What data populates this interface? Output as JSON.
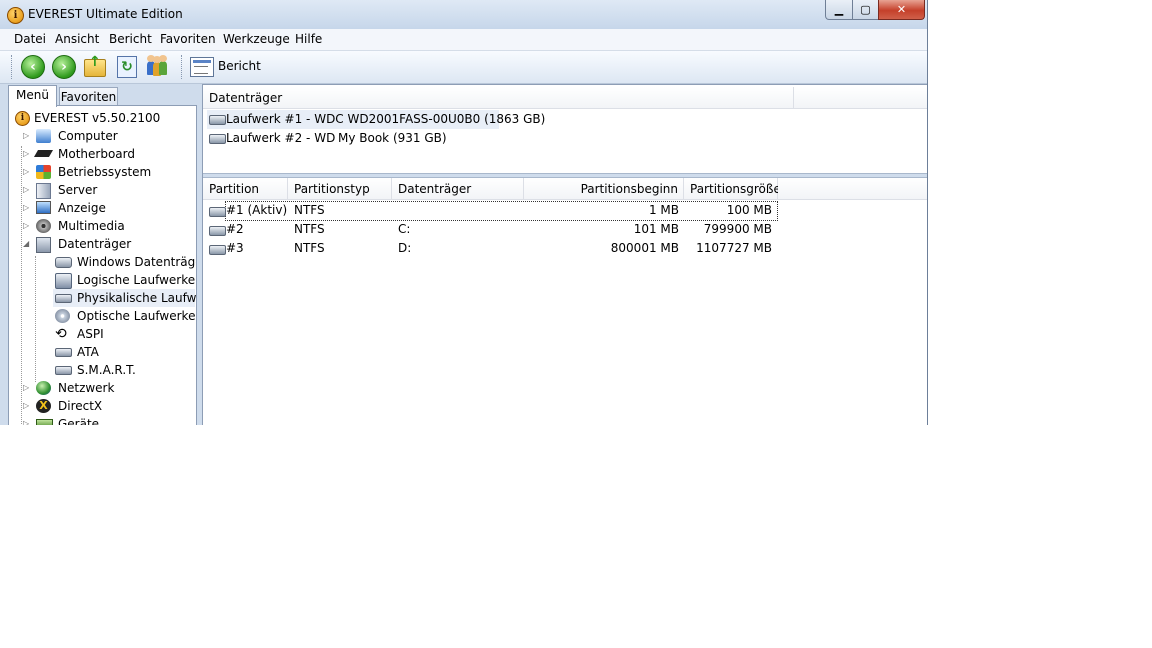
{
  "window": {
    "title": "EVEREST Ultimate Edition"
  },
  "menubar": [
    "Datei",
    "Ansicht",
    "Bericht",
    "Favoriten",
    "Werkzeuge",
    "Hilfe"
  ],
  "toolbar": {
    "icons": [
      "back-icon",
      "forward-icon",
      "up-folder-icon",
      "refresh-icon",
      "users-icon",
      "report-icon"
    ],
    "report_label": "Bericht"
  },
  "tabs": {
    "menu": "Menü",
    "favorites": "Favoriten"
  },
  "tree": {
    "root": "EVEREST v5.50.2100",
    "items": [
      "Computer",
      "Motherboard",
      "Betriebssystem",
      "Server",
      "Anzeige",
      "Multimedia",
      "Datenträger",
      "Netzwerk",
      "DirectX",
      "Geräte"
    ],
    "children": [
      "Windows Datenträger",
      "Logische Laufwerke",
      "Physikalische Laufwerk",
      "Optische Laufwerke",
      "ASPI",
      "ATA",
      "S.M.A.R.T."
    ],
    "selected": "Physikalische Laufwerk"
  },
  "drives": {
    "header": "Datenträger",
    "rows": [
      "Laufwerk #1 - WDC WD2001FASS-00U0B0 (1863 GB)",
      "Laufwerk #2 - WD",
      "My Book (931 GB)"
    ]
  },
  "partitions": {
    "headers": [
      "Partition",
      "Partitionstyp",
      "Datenträger",
      "Partitionsbeginn",
      "Partitionsgröße"
    ],
    "rows": [
      [
        "#1 (Aktiv)",
        "NTFS",
        "",
        "1 MB",
        "100 MB"
      ],
      [
        "#2",
        "NTFS",
        "C:",
        "101 MB",
        "799900 MB"
      ],
      [
        "#3",
        "NTFS",
        "D:",
        "800001 MB",
        "1107727 MB"
      ]
    ]
  },
  "colors": {
    "accent": "#cfdcec",
    "selection": "#e8eef7",
    "close": "#c5402a"
  }
}
